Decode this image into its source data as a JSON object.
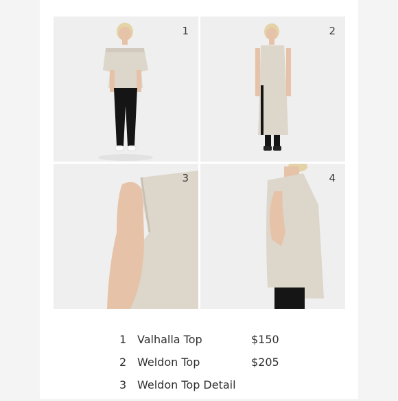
{
  "photos": [
    {
      "number": "1"
    },
    {
      "number": "2"
    },
    {
      "number": "3"
    },
    {
      "number": "4"
    }
  ],
  "legend": [
    {
      "number": "1",
      "name": "Valhalla Top",
      "price": "$150"
    },
    {
      "number": "2",
      "name": "Weldon Top",
      "price": "$205"
    },
    {
      "number": "3",
      "name": "Weldon Top Detail",
      "price": ""
    }
  ],
  "colors": {
    "linen": "#ddd6cb",
    "linen_shadow": "#c9c1b4",
    "skin": "#e6c3a8",
    "hair": "#e3d3a6",
    "pants": "#151515",
    "backdrop": "#eeeeee",
    "text": "#2f2f2f"
  }
}
